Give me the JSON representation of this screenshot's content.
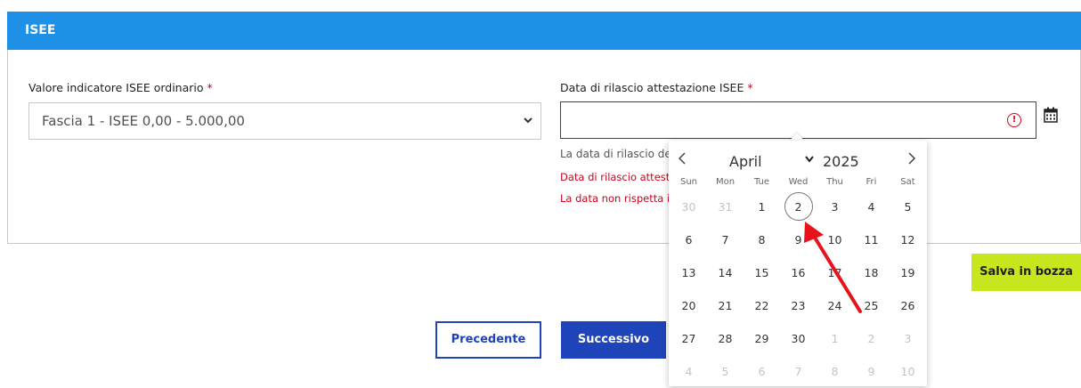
{
  "section": {
    "title": "ISEE"
  },
  "isee_value": {
    "label": "Valore indicatore ISEE ordinario",
    "required_mark": "*",
    "selected": "Fascia 1 - ISEE 0,00 - 5.000,00"
  },
  "release_date": {
    "label": "Data di rilascio attestazione ISEE",
    "required_mark": "*",
    "value": "",
    "help": "La data di rilascio de",
    "errors": [
      "Data di rilascio attesta",
      "La data non rispetta i r"
    ]
  },
  "datepicker": {
    "month": "April",
    "year": "2025",
    "weekdays": [
      "Sun",
      "Mon",
      "Tue",
      "Wed",
      "Thu",
      "Fri",
      "Sat"
    ],
    "days": [
      [
        "30",
        "31",
        "1",
        "2",
        "3",
        "4",
        "5"
      ],
      [
        "6",
        "7",
        "8",
        "9",
        "10",
        "11",
        "12"
      ],
      [
        "13",
        "14",
        "15",
        "16",
        "17",
        "18",
        "19"
      ],
      [
        "20",
        "21",
        "22",
        "23",
        "24",
        "25",
        "26"
      ],
      [
        "27",
        "28",
        "29",
        "30",
        "1",
        "2",
        "3"
      ],
      [
        "4",
        "5",
        "6",
        "7",
        "8",
        "9",
        "10"
      ]
    ],
    "muted": [
      [
        0,
        0
      ],
      [
        0,
        1
      ],
      [
        4,
        4
      ],
      [
        4,
        5
      ],
      [
        4,
        6
      ],
      [
        5,
        0
      ],
      [
        5,
        1
      ],
      [
        5,
        2
      ],
      [
        5,
        3
      ],
      [
        5,
        4
      ],
      [
        5,
        5
      ],
      [
        5,
        6
      ]
    ],
    "selected": [
      0,
      3
    ]
  },
  "buttons": {
    "draft": "Salva in bozza",
    "prev": "Precedente",
    "next": "Successivo"
  },
  "colors": {
    "header": "#1e90e6",
    "primary": "#1f43b8",
    "draft": "#c8e61d",
    "error": "#d0021b",
    "annotation_arrow": "#e8121b"
  }
}
